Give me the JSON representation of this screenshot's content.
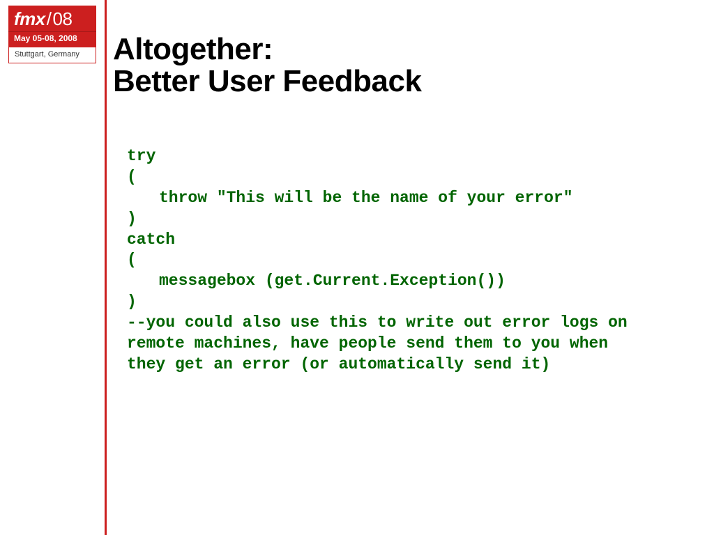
{
  "logo": {
    "brand_prefix": "fmx",
    "brand_slash": "/",
    "brand_year": "08",
    "date_line": "May 05-08, 2008",
    "location": "Stuttgart, Germany"
  },
  "headline": {
    "line1": "Altogether:",
    "line2": "Better User Feedback"
  },
  "code": {
    "l1": "try",
    "l2": "(",
    "l3_indented": "throw \"This will be the name of your error\"",
    "l4": ")",
    "l5": "catch",
    "l6": "(",
    "l7_indented": "messagebox (get.Current.Exception())",
    "l8": ")",
    "l9": "--you could also use this to write out error logs on",
    "l10": "remote machines, have people send them to you when",
    "l11": "they get an error (or automatically send it)"
  }
}
